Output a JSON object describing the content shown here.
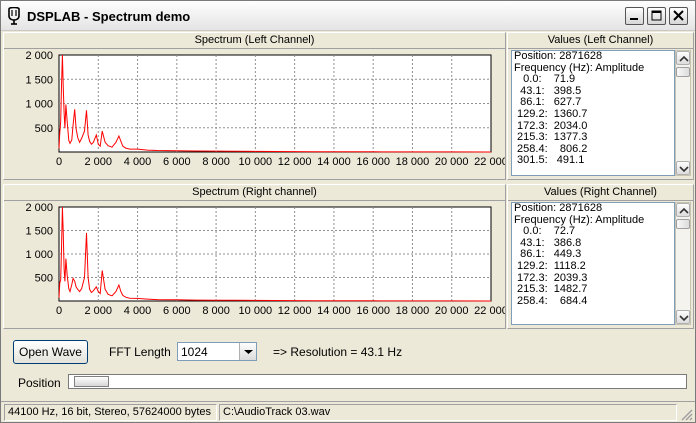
{
  "window": {
    "title": "DSPLAB - Spectrum demo"
  },
  "left_spectrum": {
    "title": "Spectrum (Left Channel)"
  },
  "right_spectrum": {
    "title": "Spectrum (Right channel)"
  },
  "left_values": {
    "title": "Values (Left Channel)",
    "lines": [
      "Position: 2871628",
      "Frequency (Hz): Amplitude",
      "   0.0:    71.9",
      "  43.1:   398.5",
      "  86.1:   627.7",
      " 129.2:  1360.7",
      " 172.3:  2034.0",
      " 215.3:  1377.3",
      " 258.4:    806.2",
      " 301.5:   491.1"
    ]
  },
  "right_values": {
    "title": "Values (Right Channel)",
    "lines": [
      "Position: 2871628",
      "Frequency (Hz): Amplitude",
      "   0.0:    72.7",
      "  43.1:   386.8",
      "  86.1:   449.3",
      " 129.2:  1118.2",
      " 172.3:  2039.3",
      " 215.3:  1482.7",
      " 258.4:    684.4"
    ]
  },
  "controls": {
    "open_wave": "Open Wave",
    "fft_length_label": "FFT Length",
    "fft_length_value": "1024",
    "resolution": "=> Resolution = 43.1 Hz",
    "position_label": "Position"
  },
  "status": {
    "format": "44100 Hz, 16 bit, Stereo, 57624000 bytes",
    "file": "C:\\AudioTrack 03.wav"
  },
  "colors": {
    "trace": "#ff0000",
    "grid": "#909090"
  },
  "chart_data": [
    {
      "type": "line",
      "title": "Spectrum (Left Channel)",
      "xlabel": "",
      "ylabel": "",
      "xlim": [
        0,
        22000
      ],
      "ylim": [
        0,
        2000
      ],
      "x_ticks": [
        "0",
        "2 000",
        "4 000",
        "6 000",
        "8 000",
        "10 000",
        "12 000",
        "14 000",
        "16 000",
        "18 000",
        "20 000",
        "22 000"
      ],
      "y_ticks": [
        "500",
        "1 000",
        "1 500",
        "2 000"
      ],
      "grid": true,
      "series": [
        {
          "x": [
            0,
            43,
            86,
            129,
            172,
            215,
            258,
            301,
            350,
            420,
            500,
            560,
            650,
            720,
            800,
            870,
            950,
            1050,
            1150,
            1300,
            1400,
            1480,
            1560,
            1650,
            1750,
            1900,
            2000,
            2100,
            2200,
            2350,
            2500,
            2700,
            2900,
            3050,
            3150,
            3250,
            3400,
            3600,
            4000,
            4500,
            5000,
            6000,
            7000,
            8000,
            9000,
            10000,
            11000,
            12000,
            13000,
            14000,
            16000,
            18000,
            20000,
            22000
          ],
          "y": [
            72,
            399,
            628,
            1361,
            2034,
            1377,
            806,
            491,
            980,
            620,
            240,
            180,
            250,
            560,
            880,
            480,
            300,
            200,
            280,
            430,
            860,
            350,
            220,
            160,
            200,
            350,
            160,
            120,
            430,
            200,
            130,
            100,
            200,
            330,
            220,
            120,
            80,
            60,
            60,
            40,
            30,
            25,
            20,
            18,
            15,
            12,
            10,
            8,
            6,
            5,
            4,
            3,
            2,
            1
          ]
        }
      ]
    },
    {
      "type": "line",
      "title": "Spectrum (Right channel)",
      "xlabel": "",
      "ylabel": "",
      "xlim": [
        0,
        22000
      ],
      "ylim": [
        0,
        2000
      ],
      "x_ticks": [
        "0",
        "2 000",
        "4 000",
        "6 000",
        "8 000",
        "10 000",
        "12 000",
        "14 000",
        "16 000",
        "18 000",
        "20 000",
        "22 000"
      ],
      "y_ticks": [
        "500",
        "1 000",
        "1 500",
        "2 000"
      ],
      "grid": true,
      "series": [
        {
          "x": [
            0,
            43,
            86,
            129,
            172,
            215,
            258,
            301,
            350,
            420,
            500,
            560,
            650,
            720,
            800,
            870,
            950,
            1050,
            1150,
            1300,
            1400,
            1480,
            1560,
            1650,
            1750,
            1900,
            2000,
            2100,
            2200,
            2350,
            2500,
            2700,
            2900,
            3050,
            3150,
            3250,
            3400,
            3600,
            4000,
            4500,
            5000,
            6000,
            7000,
            8000,
            9000,
            10000,
            11000,
            12000,
            13000,
            14000,
            16000,
            18000,
            20000,
            22000
          ],
          "y": [
            73,
            387,
            449,
            1118,
            2039,
            1483,
            684,
            420,
            900,
            540,
            260,
            200,
            350,
            480,
            420,
            300,
            250,
            200,
            260,
            500,
            1450,
            500,
            250,
            180,
            220,
            300,
            200,
            160,
            650,
            250,
            140,
            110,
            200,
            340,
            200,
            120,
            80,
            60,
            55,
            40,
            30,
            25,
            20,
            18,
            15,
            12,
            10,
            8,
            6,
            5,
            4,
            3,
            2,
            1
          ]
        }
      ]
    }
  ]
}
